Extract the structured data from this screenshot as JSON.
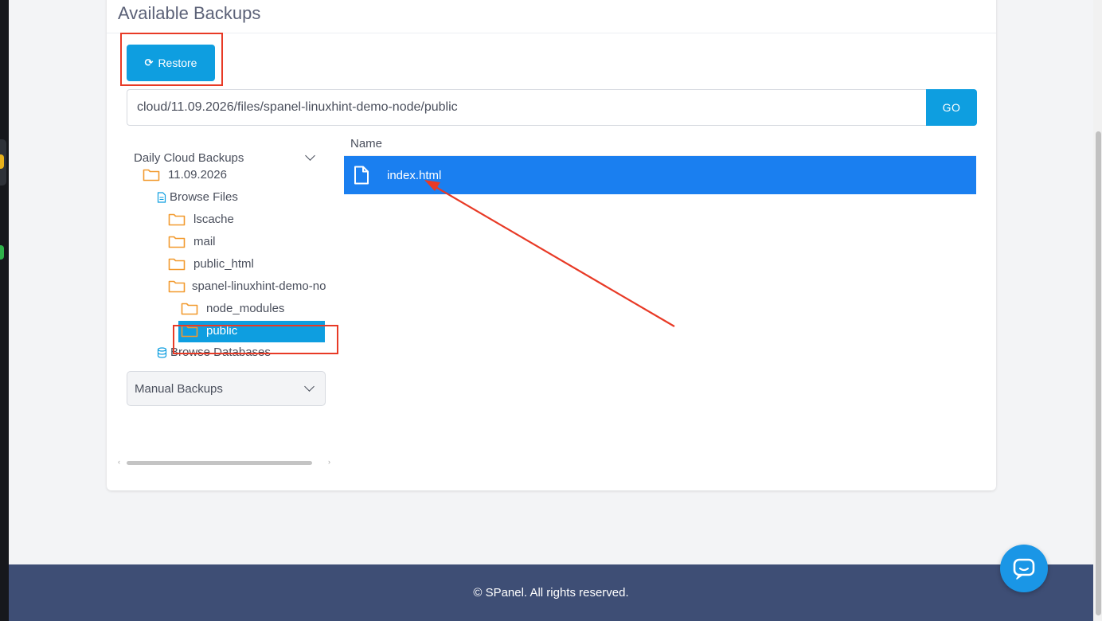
{
  "page": {
    "title": "Available Backups"
  },
  "toolbar": {
    "restore_label": "Restore",
    "restore_icon": "refresh-icon"
  },
  "path_bar": {
    "value": "cloud/11.09.2026/files/spanel-linuxhint-demo-node/public",
    "go_label": "GO"
  },
  "tree": {
    "daily_header": "Daily Cloud Backups",
    "date_folder": "11.09.2026",
    "browse_files": "Browse Files",
    "folders": [
      "lscache",
      "mail",
      "public_html",
      "spanel-linuxhint-demo-no"
    ],
    "subfolders": [
      "node_modules",
      "public"
    ],
    "selected": "public",
    "browse_databases": "Browse Databases",
    "manual_header": "Manual Backups"
  },
  "file_list": {
    "column_name": "Name",
    "rows": [
      {
        "name": "index.html",
        "icon": "file-icon",
        "selected": true
      }
    ]
  },
  "footer": {
    "text": "© SPanel. All rights reserved."
  },
  "colors": {
    "primary": "#0e9ee0",
    "row_selected": "#1a7ff0",
    "folder": "#f29a2e",
    "footer_bg": "#3e4e75",
    "annotation": "#e83a26"
  }
}
